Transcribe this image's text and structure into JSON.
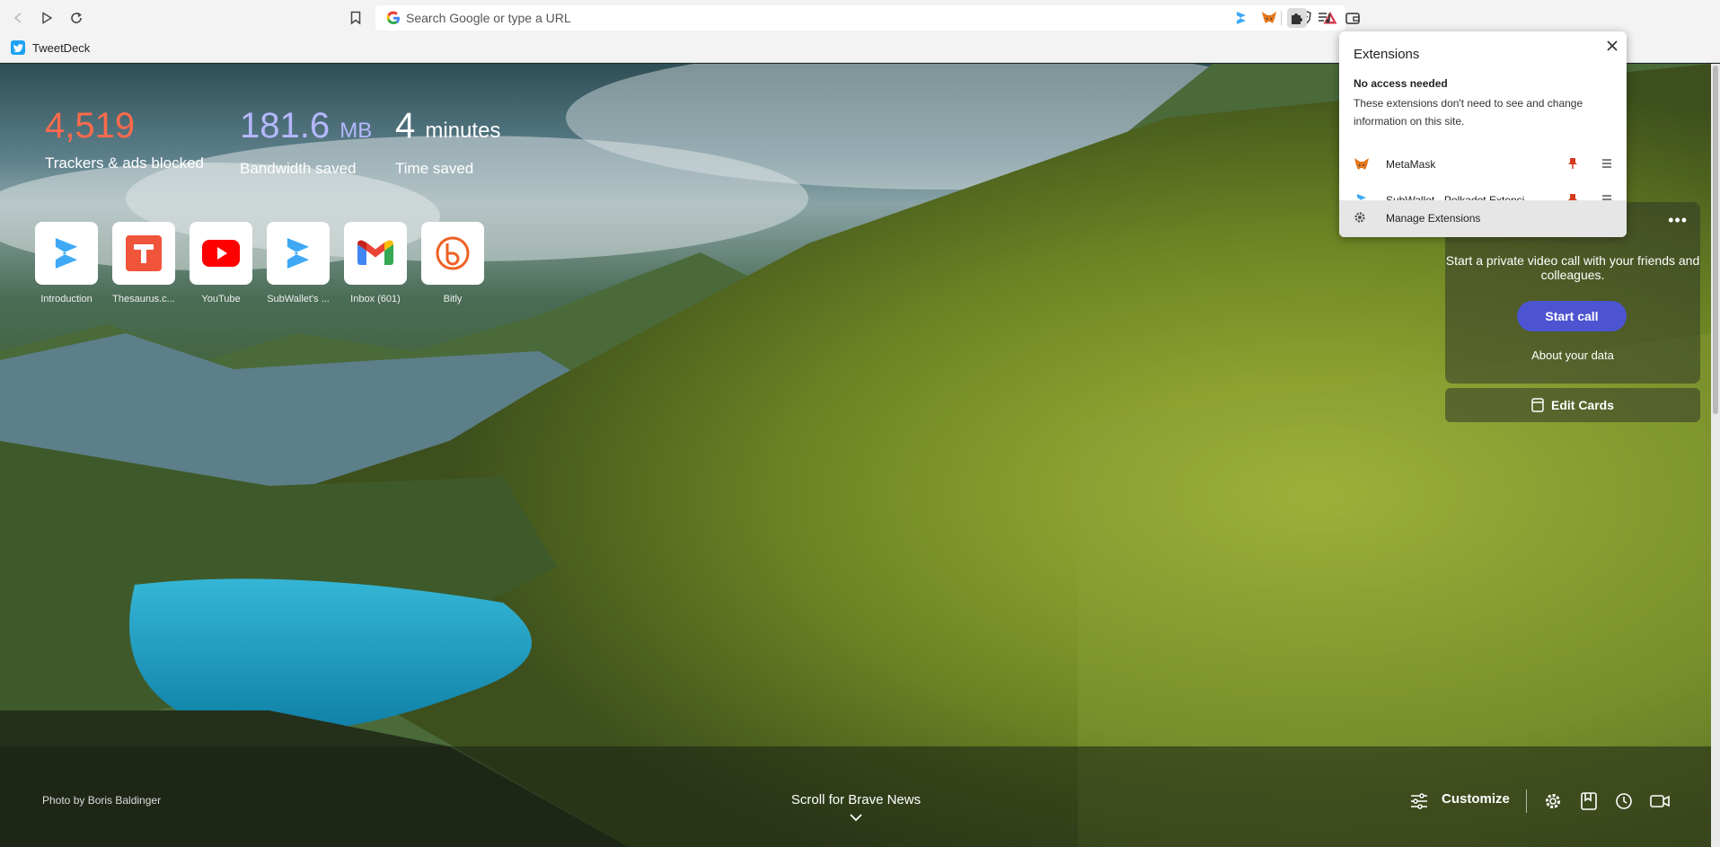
{
  "toolbar": {
    "search_placeholder": "Search Google or type a URL"
  },
  "bookmarks": {
    "items": [
      {
        "label": "TweetDeck"
      }
    ]
  },
  "stats": {
    "trackers": {
      "value": "4,519",
      "label": "Trackers & ads blocked",
      "color": "#ff6a4c"
    },
    "bandwidth": {
      "value": "181.6",
      "unit": "MB",
      "label": "Bandwidth saved",
      "color": "#b5b8ff"
    },
    "time": {
      "value": "4",
      "unit": "minutes",
      "label": "Time saved",
      "color": "#ffffff"
    }
  },
  "top_sites": [
    {
      "label": "Introduction",
      "icon": "subwallet-icon"
    },
    {
      "label": "Thesaurus.c...",
      "icon": "thesaurus-icon"
    },
    {
      "label": "YouTube",
      "icon": "youtube-icon"
    },
    {
      "label": "SubWallet's ...",
      "icon": "subwallet-icon"
    },
    {
      "label": "Inbox (601)",
      "icon": "gmail-icon"
    },
    {
      "label": "Bitly",
      "icon": "bitly-icon"
    }
  ],
  "talk_card": {
    "description": "Start a private video call with your friends and colleagues.",
    "start_label": "Start call",
    "about_label": "About your data",
    "accent": "#4c54d2"
  },
  "edit_cards": {
    "label": "Edit Cards"
  },
  "extensions_popup": {
    "title": "Extensions",
    "section_title": "No access needed",
    "section_desc": "These extensions don't need to see and change information on this site.",
    "items": [
      {
        "name": "MetaMask",
        "icon": "metamask-icon"
      },
      {
        "name": "SubWallet - Polkadot Extensi...",
        "icon": "subwallet-icon"
      }
    ],
    "manage_label": "Manage Extensions"
  },
  "footer": {
    "photo_credit": "Photo by Boris Baldinger",
    "scroll_news": "Scroll for Brave News",
    "customize_label": "Customize"
  }
}
